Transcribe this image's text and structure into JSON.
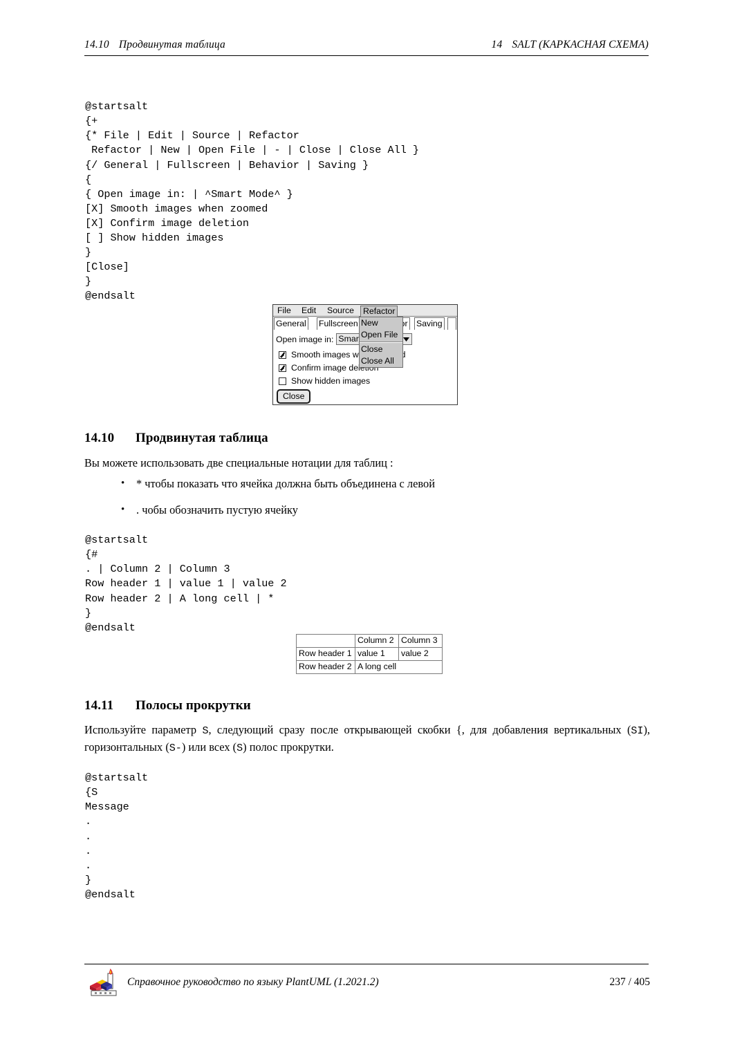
{
  "header": {
    "left_section": "14.10",
    "left_title": "Продвинутая таблица",
    "right_chapter": "14",
    "right_title": "SALT (КАРКАСНАЯ СХЕМА)"
  },
  "code_block_1": "@startsalt\n{+\n{* File | Edit | Source | Refactor\n Refactor | New | Open File | - | Close | Close All }\n{/ General | Fullscreen | Behavior | Saving }\n{\n{ Open image in: | ^Smart Mode^ }\n[X] Smooth images when zoomed\n[X] Confirm image deletion\n[ ] Show hidden images\n}\n[Close]\n}\n@endsalt",
  "code_block_2": "@startsalt\n{#\n. | Column 2 | Column 3\nRow header 1 | value 1 | value 2\nRow header 2 | A long cell | *\n}\n@endsalt",
  "code_block_3": "@startsalt\n{S\nMessage\n.\n.\n.\n.\n}\n@endsalt",
  "salt_mockup": {
    "menubar": {
      "file": "File",
      "edit": "Edit",
      "source": "Source",
      "refactor": "Refactor"
    },
    "dropdown": {
      "new": "New",
      "open_file": "Open File",
      "close": "Close",
      "close_all": "Close All"
    },
    "tabs": {
      "general": "General",
      "fullscreen": "Fullscreen",
      "behavior": "Behavior",
      "saving": "Saving"
    },
    "open_image_label": "Open image in:",
    "combo_value": "Smart Mode",
    "checkboxes": [
      {
        "label": "Smooth images when zoomed",
        "checked": true
      },
      {
        "label": "Confirm image deletion",
        "checked": true
      },
      {
        "label": "Show hidden images",
        "checked": false
      }
    ],
    "close_button": "Close"
  },
  "section_1410": {
    "number": "14.10",
    "title": "Продвинутая таблица",
    "paragraph": "Вы можете использовать две специальные нотации для таблиц :",
    "bullets": [
      {
        "marker": "•",
        "text": "* чтобы показать что ячейка должна быть объединена с левой"
      },
      {
        "marker": "•",
        "text": ".  чобы обозначить пустую ячейку"
      }
    ]
  },
  "salt_table": {
    "rows": [
      [
        "",
        "Column 2",
        "Column 3"
      ],
      [
        "Row header 1",
        "value 1",
        "value 2"
      ],
      [
        "Row header 2",
        "A long cell",
        ""
      ]
    ]
  },
  "section_1411": {
    "number": "14.11",
    "title": "Полосы прокрутки",
    "paragraph_part1": "Используйте параметр ",
    "param_s": "S",
    "paragraph_part2": ", следующий сразу после открывающей скобки {, для добавления вертикальных (",
    "param_si": "SI",
    "paragraph_part3": "), горизонтальных (",
    "param_sh": "S-",
    "paragraph_part4": ") или всех (",
    "param_sall": "S",
    "paragraph_part5": ") полос прокрутки."
  },
  "footer": {
    "title": "Справочное руководство по языку PlantUML (1.2021.2)",
    "page": "237 / 405"
  },
  "colors": {
    "menu_highlight": "#c9c9c9",
    "menubar_bg": "#e8e8e8",
    "border": "#6e6e6e",
    "logo_red": "#cf2233",
    "logo_blue": "#2b2f8f",
    "logo_yellow": "#f2c200"
  }
}
